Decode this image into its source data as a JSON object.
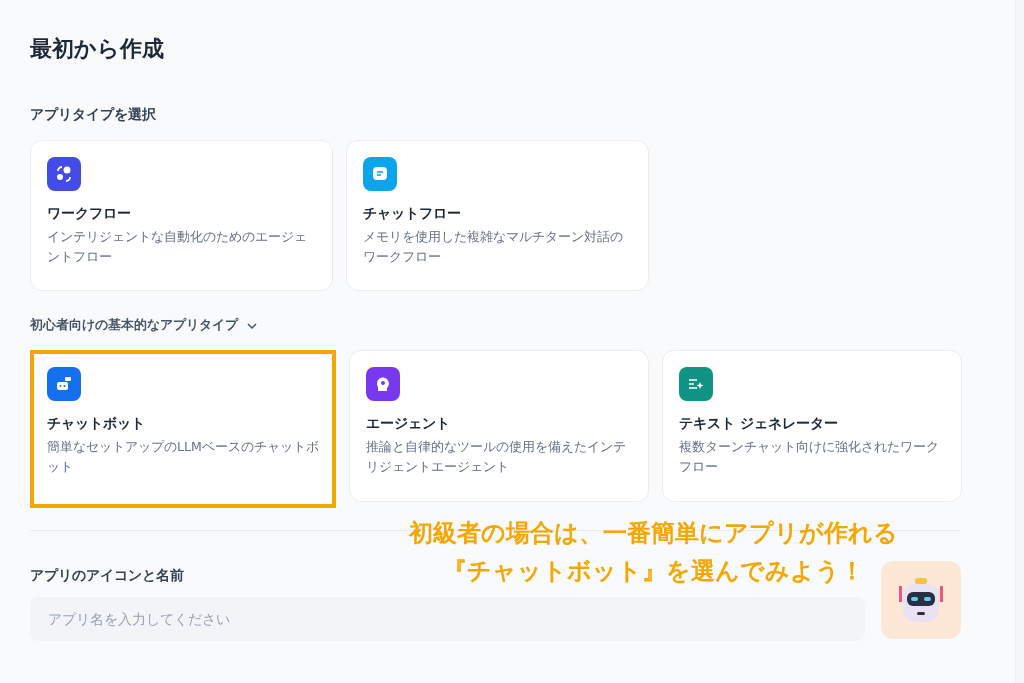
{
  "title": "最初から作成",
  "app_type_section": {
    "label": "アプリタイプを選択",
    "types": [
      {
        "kind": "workflow",
        "name": "ワークフロー",
        "description": "インテリジェントな自動化のためのエージェントフロー"
      },
      {
        "kind": "chatflow",
        "name": "チャットフロー",
        "description": "メモリを使用した複雑なマルチターン対話のワークフロー"
      }
    ]
  },
  "basic_section": {
    "label": "初心者向けの基本的なアプリタイプ",
    "expanded": true,
    "types": [
      {
        "kind": "chatbot",
        "name": "チャットボット",
        "description": "簡単なセットアップのLLMベースのチャットボット",
        "highlighted": true
      },
      {
        "kind": "agent",
        "name": "エージェント",
        "description": "推論と自律的なツールの使用を備えたインテリジェントエージェント",
        "highlighted": false
      },
      {
        "kind": "textgen",
        "name": "テキスト ジェネレーター",
        "description": "複数ターンチャット向けに強化されたワークフロー",
        "highlighted": false
      }
    ]
  },
  "name_section": {
    "label": "アプリのアイコンと名前",
    "placeholder": "アプリ名を入力してください"
  },
  "annotation": [
    "初級者の場合は、一番簡単にアプリが作れる",
    "『チャットボット』を選んでみよう！"
  ]
}
